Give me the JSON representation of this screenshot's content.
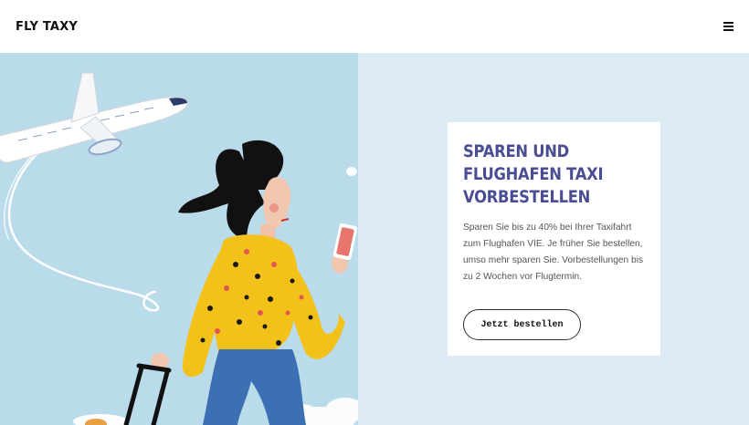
{
  "header": {
    "logo": "FLY TAXY",
    "menu_icon": "hamburger-menu-icon"
  },
  "hero": {
    "title_lines": [
      "SPAREN UND",
      "FLUGHAFEN TAXI",
      "VORBESTELLEN"
    ],
    "description": "Sparen Sie bis zu 40% bei Ihrer Taxifahrt zum Flughafen VIE. Je früher Sie bestellen, umso mehr sparen Sie. Vorbestellungen bis zu 2 Wochen vor Flugtermin.",
    "cta_label": "Jetzt bestellen"
  },
  "colors": {
    "accent": "#4a4d94",
    "sky": "#b9dbea",
    "panel": "#dcecf2",
    "sweater": "#f2c21b"
  }
}
